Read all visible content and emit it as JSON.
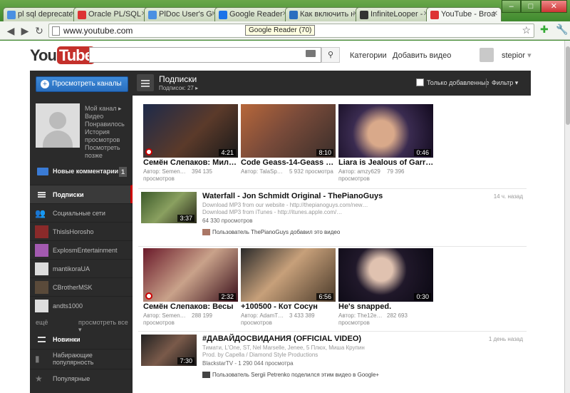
{
  "browser": {
    "tabs": [
      {
        "title": "pl sql deprecated",
        "fav": "#4a90e2"
      },
      {
        "title": "Oracle PL/SQL W",
        "fav": "#d33"
      },
      {
        "title": "PlDoc User's Gui",
        "fav": "#4a90e2"
      },
      {
        "title": "Google Reader",
        "fav": "#1a73e8"
      },
      {
        "title": "Как включить н",
        "fav": "#2a6fbf"
      },
      {
        "title": "InfiniteLooper -",
        "fav": "#333"
      },
      {
        "title": "YouTube - Broad",
        "fav": "#d33"
      }
    ],
    "url": "www.youtube.com",
    "tooltip": "Google Reader (70)",
    "win": {
      "min": "–",
      "max": "□",
      "close": "✕"
    }
  },
  "header": {
    "logo_you": "You",
    "logo_tube": "Tube",
    "search_value": "",
    "categories": "Категории",
    "upload": "Добавить видео",
    "username": "stepior"
  },
  "sidebar": {
    "subscribe_button": "Просмотреть каналы",
    "my_links": [
      "Мой канал ▸",
      "Видео",
      "Понравилось",
      "История просмотров",
      "Посмотреть позже"
    ],
    "new_comments": "Новые комментарии",
    "new_comments_count": "1",
    "items": [
      {
        "label": "Подписки"
      },
      {
        "label": "Социальные сети"
      },
      {
        "label": "ThislsHorosho"
      },
      {
        "label": "ExplosmEntertainment"
      },
      {
        "label": "mantikoraUA"
      },
      {
        "label": "CBrotherMSK"
      },
      {
        "label": "andts1000"
      }
    ],
    "more": "ещё",
    "view_all": "просмотреть все ▾",
    "new_label": "Новинки",
    "popular_now": "Набирающие популярность",
    "popular": "Популярные"
  },
  "main": {
    "title": "Подписки",
    "subtitle": "Подписок: 27 ▸",
    "only_added": "Только добавленные",
    "filter": "Фильтр ▾",
    "row1": [
      {
        "title": "Семён Слепаков: Мил…",
        "author": "Автор: Semen…",
        "views": "394 135",
        "views_label": "просмотров",
        "duration": "4:21"
      },
      {
        "title": "Code Geass-14-Geass …",
        "author": "Автор: TalaSp…",
        "views": "5 932 просмотра",
        "views_label": "",
        "duration": "8:10"
      },
      {
        "title": "Liara is Jealous of Garr…",
        "author": "Автор: amzy629",
        "views": "79 396",
        "views_label": "просмотров",
        "duration": "0:46"
      }
    ],
    "wide1": {
      "title": "Waterfall - Jon Schmidt Original - ThePianoGuys",
      "age": "14 ч. назад",
      "desc1": "Download MP3 from our website - http://thepianoguys.com/new…",
      "desc2": "Download MP3 from iTunes - http://itunes.apple.com/…",
      "views": "64 330 просмотров",
      "activity": "Пользователь ThePianoGuys добавил это видео",
      "duration": "3:37"
    },
    "row2": [
      {
        "title": "Семён Слепаков: Весы",
        "author": "Автор: Semen…",
        "views": "288 199",
        "views_label": "просмотров",
        "duration": "2:32"
      },
      {
        "title": "+100500 - Кот Сосун",
        "author": "Автор: AdamT…",
        "views": "3 433 389",
        "views_label": "просмотров",
        "duration": "6:56"
      },
      {
        "title": "He's snapped.",
        "author": "Автор: The12e…",
        "views": "282 693",
        "views_label": "просмотров",
        "duration": "0:30"
      }
    ],
    "wide2": {
      "title": "#ДАВАЙДОСВИДАНИЯ (OFFICIAL VIDEO)",
      "age": "1 день назад",
      "desc1": "Тимати, L'One, ST, Nel Marselle, Jenee, 5 Плюх, Миша Крупин",
      "desc2": "Prod. by Capella / Diamond Style Productions",
      "views": "BlackstarTV - 1 290 044 просмотра",
      "activity": "Пользователь Sergii Petrenko поделился этим видео в Google+",
      "duration": "7:30"
    }
  },
  "colors": {
    "accent": "#c4302b",
    "link_blue": "#2a6fbf",
    "chrome_green": "#3f8a2e"
  }
}
